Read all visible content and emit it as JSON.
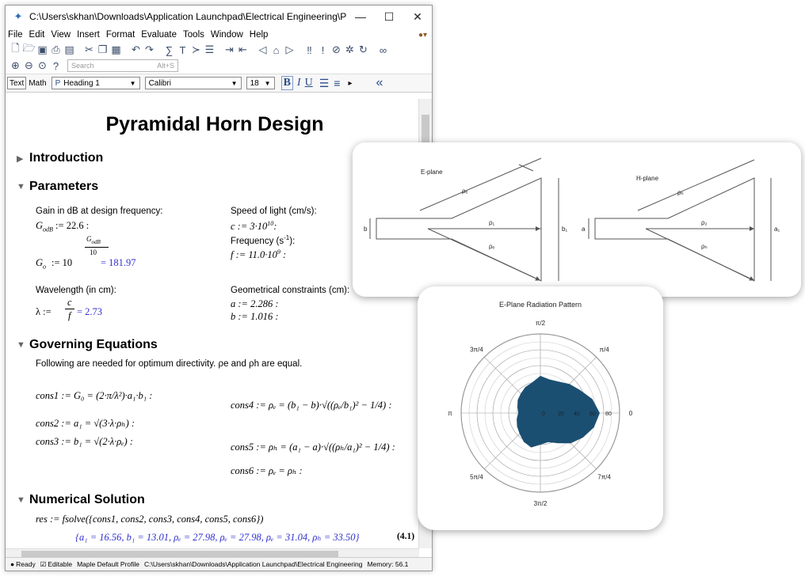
{
  "window": {
    "title": "C:\\Users\\skhan\\Downloads\\Application Launchpad\\Electrical Engineering\\Pyramidal Hor...",
    "minimize": "—",
    "maximize": "☐",
    "close": "✕"
  },
  "menu": [
    "File",
    "Edit",
    "View",
    "Insert",
    "Format",
    "Evaluate",
    "Tools",
    "Window",
    "Help"
  ],
  "toolbar": {
    "search_placeholder": "Search",
    "search_shortcut": "Alt+S"
  },
  "format_bar": {
    "text_tab": "Text",
    "math_tab": "Math",
    "style": "Heading 1",
    "font": "Calibri",
    "size": "18",
    "bold": "B",
    "italic": "I",
    "underline": "U",
    "collapse": "«"
  },
  "document": {
    "title": "Pyramidal Horn Design",
    "sections": {
      "introduction": "Introduction",
      "parameters": "Parameters",
      "governing": "Governing Equations",
      "numerical": "Numerical Solution"
    },
    "params": {
      "gain_label": "Gain in dB at design frequency:",
      "gain_def": "G",
      "gain_sub": "odB",
      "gain_val": ":= 22.6 :",
      "g_def": "G",
      "g_sub": "o",
      "g_assign": ":= 10",
      "g_exp_num": "G",
      "g_exp_sub": "odB",
      "g_exp_den": "10",
      "g_result": "= 181.97",
      "wavelength_label": "Wavelength (in cm):",
      "lambda_def": "λ :=",
      "lambda_num": "c",
      "lambda_den": "f",
      "lambda_result": "= 2.73",
      "speed_label": "Speed of light (cm/s):",
      "speed_def": "c := 3·10",
      "speed_exp": "10",
      "speed_end": ":",
      "freq_label": "Frequency (s",
      "freq_exp": "-1",
      "freq_end": "):",
      "freq_def": "f := 11.0·10",
      "freq_def_exp": "9",
      "freq_def_end": " :",
      "geom_label": "Geometrical constraints (cm):",
      "a_def": "a := 2.286 :",
      "b_def": "b := 1.016 :"
    },
    "governing_text": "Following are needed for optimum directivity. ρe and ρh are equal.",
    "equations": {
      "cons1": "cons1 := G₀ = (2·π/λ²)·a₁·b₁ :",
      "cons2": "cons2 := a₁ = √(3·λ·ρₕ) :",
      "cons3": "cons3 := b₁ = √(2·λ·ρₑ) :",
      "cons4": "cons4 := ρₑ = (b₁ − b)·√((ρₑ/b₁)² − 1/4) :",
      "cons5": "cons5 := ρₕ = (a₁ − a)·√((ρₕ/a₁)² − 1/4) :",
      "cons6": "cons6 := ρₑ = ρₕ :"
    },
    "solve_cmd": "res := fsolve({cons1, cons2, cons3, cons4, cons5, cons6})",
    "solution": "{a₁ = 16.56, b₁ = 13.01, ρₑ = 27.98, ρₑ = 27.98, ρₑ = 31.04, ρₕ = 33.50}",
    "eq_label": "(4.1)"
  },
  "statusbar": {
    "ready": "Ready",
    "editable": "Editable",
    "profile": "Maple Default Profile",
    "path": "C:\\Users\\skhan\\Downloads\\Application Launchpad\\Electrical Engineering",
    "memory": "Memory: 56.1"
  },
  "horn_diagram": {
    "eplane_title": "E-plane",
    "hplane_title": "H-plane",
    "rho_e": "ρₑ",
    "rho_1": "ρ₁",
    "b": "b",
    "b1": "b₁",
    "rho_h": "ρₕ",
    "rho_2": "ρ₂",
    "a": "a",
    "a1": "a₁"
  },
  "chart_data": {
    "type": "polar",
    "title": "E-Plane Radiation Pattern",
    "angle_ticks": [
      "0",
      "π/4",
      "π/2",
      "3π/4",
      "π",
      "5π/4",
      "3π/2",
      "7π/4"
    ],
    "radial_ticks": [
      "0",
      "20",
      "40",
      "60",
      "80"
    ],
    "rmax": 100,
    "fill_color": "#1b4f72",
    "pattern_deg": [
      0,
      15,
      30,
      45,
      60,
      75,
      90,
      105,
      120,
      135,
      150,
      165,
      180,
      195,
      210,
      225,
      240,
      255,
      270,
      285,
      300,
      315,
      330,
      345
    ],
    "pattern_r": [
      75,
      68,
      58,
      52,
      46,
      44,
      47,
      40,
      38,
      35,
      33,
      30,
      28,
      31,
      34,
      37,
      42,
      45,
      40,
      38,
      44,
      54,
      62,
      70
    ]
  }
}
